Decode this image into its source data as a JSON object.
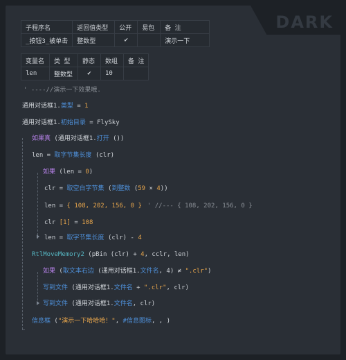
{
  "brand": "DARK",
  "sub_table": {
    "headers": [
      "子程序名",
      "返回值类型",
      "公开",
      "易包",
      "备 注"
    ],
    "row": {
      "name": "_按钮3_被单击",
      "ret_type": "整数型",
      "public": "✔",
      "epkg": "",
      "note": "演示一下"
    }
  },
  "var_table": {
    "headers": [
      "变量名",
      "类 型",
      "静态",
      "数组",
      "备 注"
    ],
    "row": {
      "name": "len",
      "type": "整数型",
      "static": "✔",
      "array": "10",
      "note": ""
    }
  },
  "code": {
    "comment1": "' ----//演示一下效果哦.",
    "l1": {
      "obj": "通用对话框1.",
      "prop": "类型",
      "eq": " = ",
      "val": "1"
    },
    "l2": {
      "obj": "通用对话框1.",
      "prop": "初始目录",
      "eq": " = ",
      "val": "FlySky"
    },
    "if1": {
      "kw": "如果真",
      "args_a": " (通用对话框1.",
      "fn": "打开",
      "args_b": " ())"
    },
    "l3": {
      "var": "len",
      "eq": " = ",
      "fn": "取字节集长度",
      "args": " (clr)"
    },
    "if2": {
      "kw": "如果",
      "args_a": " (len ",
      "eq": "= ",
      "val": "0",
      "close": ")"
    },
    "l4": {
      "var": "clr",
      "eq": " = ",
      "fn": "取空白字节集",
      "a": " (",
      "fn2": "到整数",
      "b": " (",
      "n1": "59",
      "op": " × ",
      "n2": "4",
      "c": "))"
    },
    "l5": {
      "var": "len",
      "eq": " = ",
      "arr": "{ 108, 202, 156, 0 }",
      "cmt": "' //--- { 108, 202, 156, 0 }"
    },
    "l6": {
      "var": "clr ",
      "idx": "[1]",
      "eq": " = ",
      "val": "108"
    },
    "l7": {
      "var": "len",
      "eq": " = ",
      "fn": "取字节集长度",
      "args": " (clr) ",
      "op": "- ",
      "val": "4"
    },
    "l8": {
      "fn": "RtlMoveMemory2",
      "a": " (pBin (clr) ",
      "op": "+ ",
      "n": "4",
      "b": ", cclr, len)"
    },
    "if3": {
      "kw": "如果",
      "a": " (",
      "fn": "取文本右边",
      "b": " (通用对话框1.",
      "prop": "文件名",
      "c": ", 4) ≠  ",
      "str": "\".clr\"",
      "d": ")"
    },
    "l9": {
      "fn": "写到文件",
      "a": " (通用对话框1.",
      "prop": "文件名",
      "op": " +  ",
      "str": "\".clr\"",
      "b": ", clr)"
    },
    "l10": {
      "fn": "写到文件",
      "a": " (通用对话框1.",
      "prop": "文件名",
      "b": ", clr)"
    },
    "l11": {
      "fn": "信息框",
      "a": " (",
      "str": "\"演示一下哈哈哈！\"",
      "b": ", ",
      "c": "#信息图标",
      "d": ", , )"
    }
  }
}
